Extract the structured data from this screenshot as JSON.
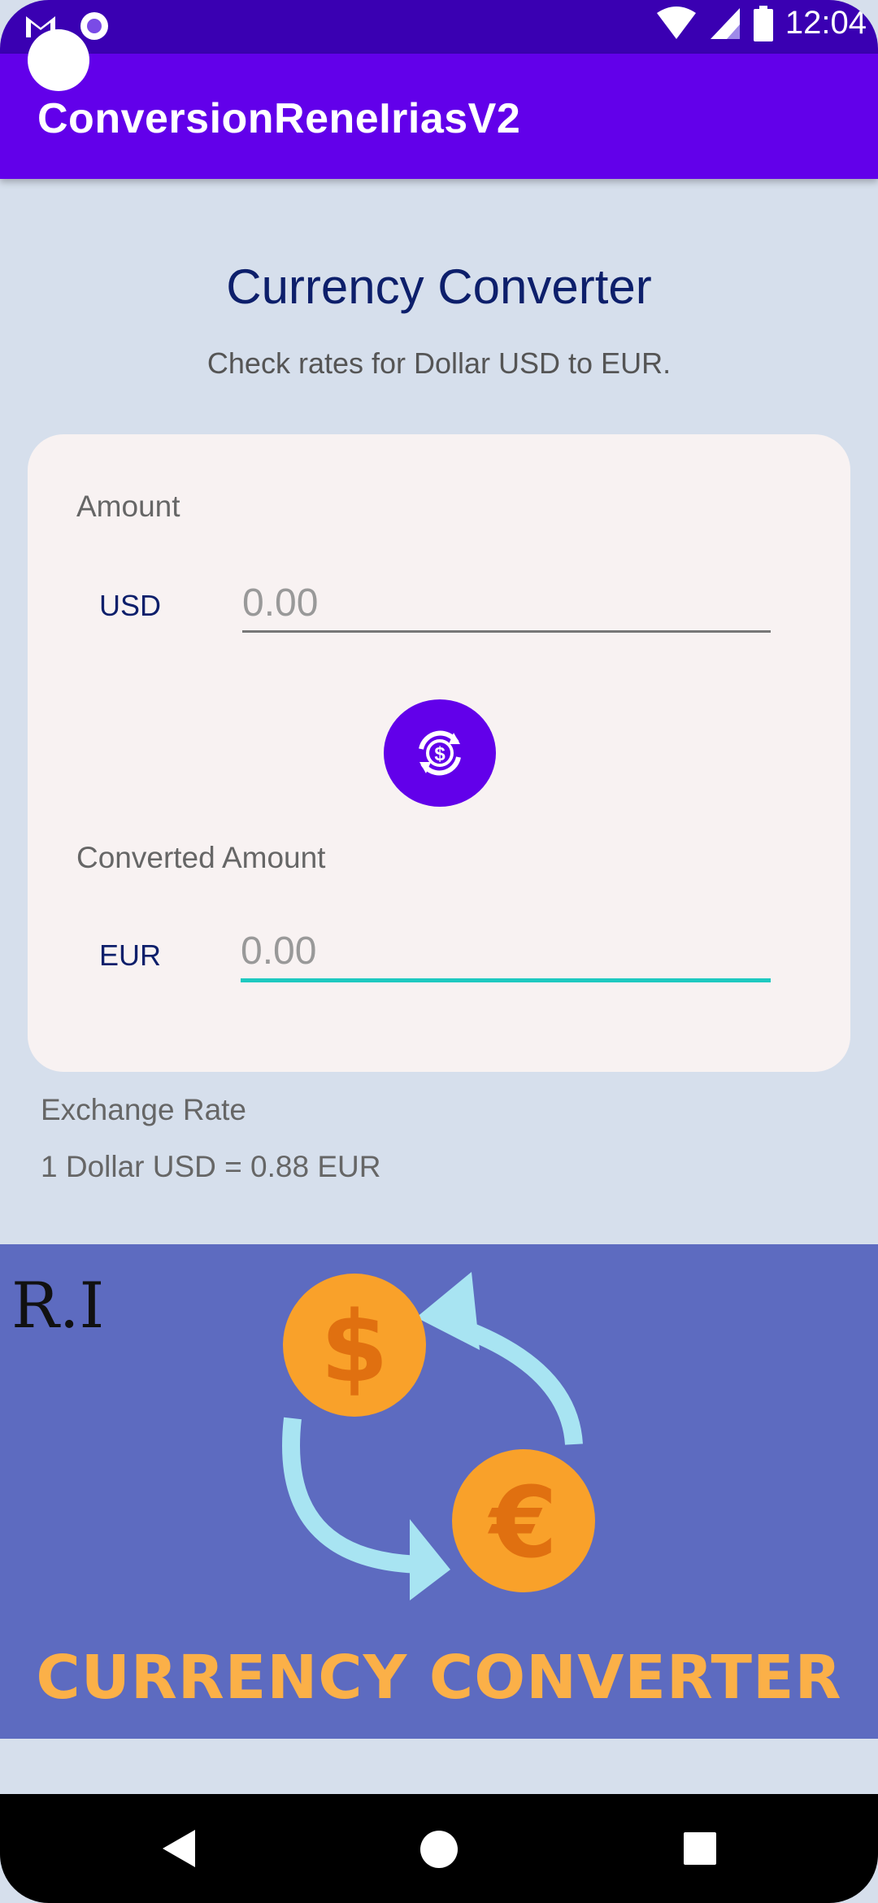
{
  "status_bar": {
    "time": "12:04",
    "icons": [
      "gmail-icon",
      "record-icon",
      "wifi-icon",
      "signal-icon",
      "battery-icon"
    ]
  },
  "app_bar": {
    "title": "ConversionReneIriasV2"
  },
  "header": {
    "title": "Currency Converter",
    "subtitle": "Check rates for Dollar USD to EUR."
  },
  "card": {
    "amount_label": "Amount",
    "from_currency": "USD",
    "from_placeholder": "0.00",
    "converted_label": "Converted Amount",
    "to_currency": "EUR",
    "to_placeholder": "0.00",
    "convert_icon": "currency-exchange-icon"
  },
  "exchange": {
    "title": "Exchange Rate",
    "rate_text": "1 Dollar USD = 0.88 EUR"
  },
  "banner": {
    "initials": "R.I",
    "dollar_symbol": "$",
    "euro_symbol": "€",
    "caption": "CURRENCY CONVERTER",
    "colors": {
      "background": "#5d6bc0",
      "coin": "#f9a12a",
      "coin_symbol": "#e07010",
      "arrow": "#a8e4f2",
      "caption": "#fbb048"
    }
  },
  "nav_bar": {
    "icons": [
      "back-icon",
      "home-icon",
      "recents-icon"
    ]
  },
  "colors": {
    "primary": "#6200ea",
    "status_bar": "#3a00b2",
    "accent": "#1ec9c0",
    "background": "#d6dfec",
    "card": "#f8f2f2"
  }
}
